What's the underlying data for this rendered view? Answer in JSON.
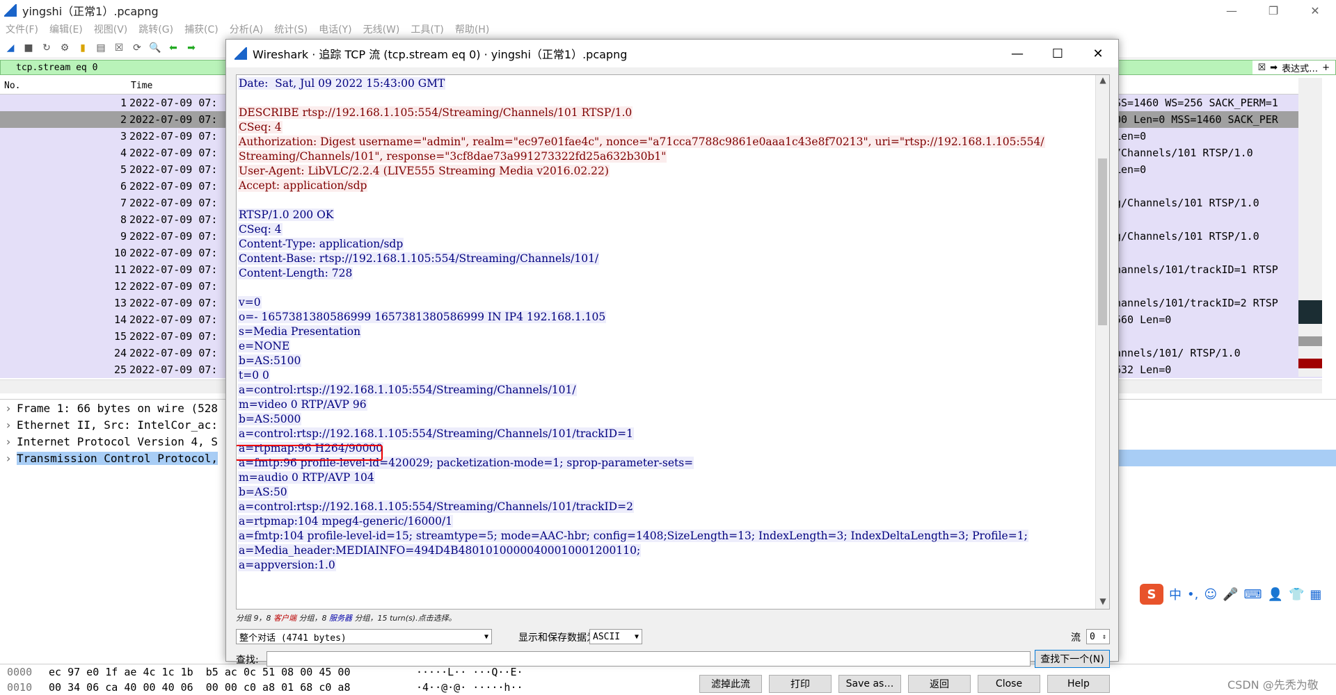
{
  "main": {
    "title": "yingshi（正常1）.pcapng",
    "menu": [
      "文件(F)",
      "编辑(E)",
      "视图(V)",
      "跳转(G)",
      "捕获(C)",
      "分析(A)",
      "统计(S)",
      "电话(Y)",
      "无线(W)",
      "工具(T)",
      "帮助(H)"
    ],
    "filter_text": "tcp.stream eq 0",
    "filter_expression_label": "表达式…",
    "columns": {
      "no": "No.",
      "time": "Time"
    },
    "packets": [
      {
        "no": "1",
        "time": "2022-07-09 07:",
        "info": "SS=1460 WS=256 SACK_PERM=1"
      },
      {
        "no": "2",
        "time": "2022-07-09 07:",
        "info": "00 Len=0 MSS=1460 SACK_PER"
      },
      {
        "no": "3",
        "time": "2022-07-09 07:",
        "info": "Len=0"
      },
      {
        "no": "4",
        "time": "2022-07-09 07:",
        "info": "/Channels/101 RTSP/1.0"
      },
      {
        "no": "5",
        "time": "2022-07-09 07:",
        "info": "Len=0"
      },
      {
        "no": "6",
        "time": "2022-07-09 07:",
        "info": ""
      },
      {
        "no": "7",
        "time": "2022-07-09 07:",
        "info": "g/Channels/101 RTSP/1.0"
      },
      {
        "no": "8",
        "time": "2022-07-09 07:",
        "info": ""
      },
      {
        "no": "9",
        "time": "2022-07-09 07:",
        "info": "g/Channels/101 RTSP/1.0"
      },
      {
        "no": "10",
        "time": "2022-07-09 07:",
        "info": ""
      },
      {
        "no": "11",
        "time": "2022-07-09 07:",
        "info": "hannels/101/trackID=1 RTSP"
      },
      {
        "no": "12",
        "time": "2022-07-09 07:",
        "info": ""
      },
      {
        "no": "13",
        "time": "2022-07-09 07:",
        "info": "hannels/101/trackID=2 RTSP"
      },
      {
        "no": "14",
        "time": "2022-07-09 07:",
        "info": "560 Len=0"
      },
      {
        "no": "15",
        "time": "2022-07-09 07:",
        "info": ""
      },
      {
        "no": "24",
        "time": "2022-07-09 07:",
        "info": "annels/101/ RTSP/1.0"
      },
      {
        "no": "25",
        "time": "2022-07-09 07:",
        "info": "632 Len=0"
      }
    ],
    "details": [
      "Frame 1: 66 bytes on wire (528",
      "Ethernet II, Src: IntelCor_ac:",
      "Internet Protocol Version 4, S",
      "Transmission Control Protocol,"
    ],
    "hex": [
      {
        "off": "0000",
        "hex": "ec 97 e0 1f ae 4c 1c 1b  b5 ac 0c 51 08 00 45 00",
        "ascii": "·····L·· ···Q··E·"
      },
      {
        "off": "0010",
        "hex": "00 34 06 ca 40 00 40 06  00 00 c0 a8 01 68 c0 a8",
        "ascii": "·4··@·@· ·····h··"
      }
    ],
    "watermark": "CSDN @先秃为敬"
  },
  "dialog": {
    "title": "Wireshark · 追踪 TCP 流 (tcp.stream eq 0) · yingshi（正常1）.pcapng",
    "lines": [
      {
        "t": "Date:  Sat, Jul 09 2022 15:43:00 GMT",
        "s": "srv"
      },
      {
        "t": "",
        "s": "blank"
      },
      {
        "t": "DESCRIBE rtsp://192.168.1.105:554/Streaming/Channels/101 RTSP/1.0",
        "s": "cli"
      },
      {
        "t": "CSeq: 4",
        "s": "cli"
      },
      {
        "t": "Authorization: Digest username=\"admin\", realm=\"ec97e01fae4c\", nonce=\"a71cca7788c9861e0aaa1c43e8f70213\", uri=\"rtsp://192.168.1.105:554/",
        "s": "cli"
      },
      {
        "t": "Streaming/Channels/101\", response=\"3cf8dae73a991273322fd25a632b30b1\"",
        "s": "cli"
      },
      {
        "t": "User-Agent: LibVLC/2.2.4 (LIVE555 Streaming Media v2016.02.22)",
        "s": "cli"
      },
      {
        "t": "Accept: application/sdp",
        "s": "cli"
      },
      {
        "t": "",
        "s": "blank"
      },
      {
        "t": "RTSP/1.0 200 OK",
        "s": "srv"
      },
      {
        "t": "CSeq: 4",
        "s": "srv"
      },
      {
        "t": "Content-Type: application/sdp",
        "s": "srv"
      },
      {
        "t": "Content-Base: rtsp://192.168.1.105:554/Streaming/Channels/101/",
        "s": "srv"
      },
      {
        "t": "Content-Length: 728",
        "s": "srv"
      },
      {
        "t": "",
        "s": "blank"
      },
      {
        "t": "v=0",
        "s": "srv"
      },
      {
        "t": "o=- 1657381380586999 1657381380586999 IN IP4 192.168.1.105",
        "s": "srv"
      },
      {
        "t": "s=Media Presentation",
        "s": "srv"
      },
      {
        "t": "e=NONE",
        "s": "srv"
      },
      {
        "t": "b=AS:5100",
        "s": "srv"
      },
      {
        "t": "t=0 0",
        "s": "srv"
      },
      {
        "t": "a=control:rtsp://192.168.1.105:554/Streaming/Channels/101/",
        "s": "srv"
      },
      {
        "t": "m=video 0 RTP/AVP 96",
        "s": "srv"
      },
      {
        "t": "b=AS:5000",
        "s": "srv"
      },
      {
        "t": "a=control:rtsp://192.168.1.105:554/Streaming/Channels/101/trackID=1",
        "s": "srv"
      },
      {
        "t": "a=rtpmap:96 H264/90000",
        "s": "srv"
      },
      {
        "t": "a=fmtp:96 profile-level-id=420029; packetization-mode=1; sprop-parameter-sets=",
        "s": "srv"
      },
      {
        "t": "m=audio 0 RTP/AVP 104",
        "s": "srv"
      },
      {
        "t": "b=AS:50",
        "s": "srv"
      },
      {
        "t": "a=control:rtsp://192.168.1.105:554/Streaming/Channels/101/trackID=2",
        "s": "srv"
      },
      {
        "t": "a=rtpmap:104 mpeg4-generic/16000/1",
        "s": "srv"
      },
      {
        "t": "a=fmtp:104 profile-level-id=15; streamtype=5; mode=AAC-hbr; config=1408;SizeLength=13; IndexLength=3; IndexDeltaLength=3; Profile=1;",
        "s": "srv"
      },
      {
        "t": "a=Media_header:MEDIAINFO=494D4B48010100000400010001200110;",
        "s": "srv"
      },
      {
        "t": "a=appversion:1.0",
        "s": "srv"
      }
    ],
    "summary": {
      "p1": "分组 9，8 ",
      "client": "客户端",
      "p2": " 分组，8 ",
      "server": "服务器",
      "p3": " 分组，15 turn(s).点击选择。"
    },
    "conversation_select": "整个对话 (4741 bytes)",
    "show_save_label": "显示和保存数据为",
    "format_select": "ASCII",
    "stream_label": "流",
    "stream_value": "0",
    "find_label": "查找:",
    "find_value": "",
    "find_next": "查找下一个(N)",
    "buttons": {
      "filter_out": "滤掉此流",
      "print": "打印",
      "save_as": "Save as…",
      "back": "返回",
      "close": "Close",
      "help": "Help"
    }
  }
}
